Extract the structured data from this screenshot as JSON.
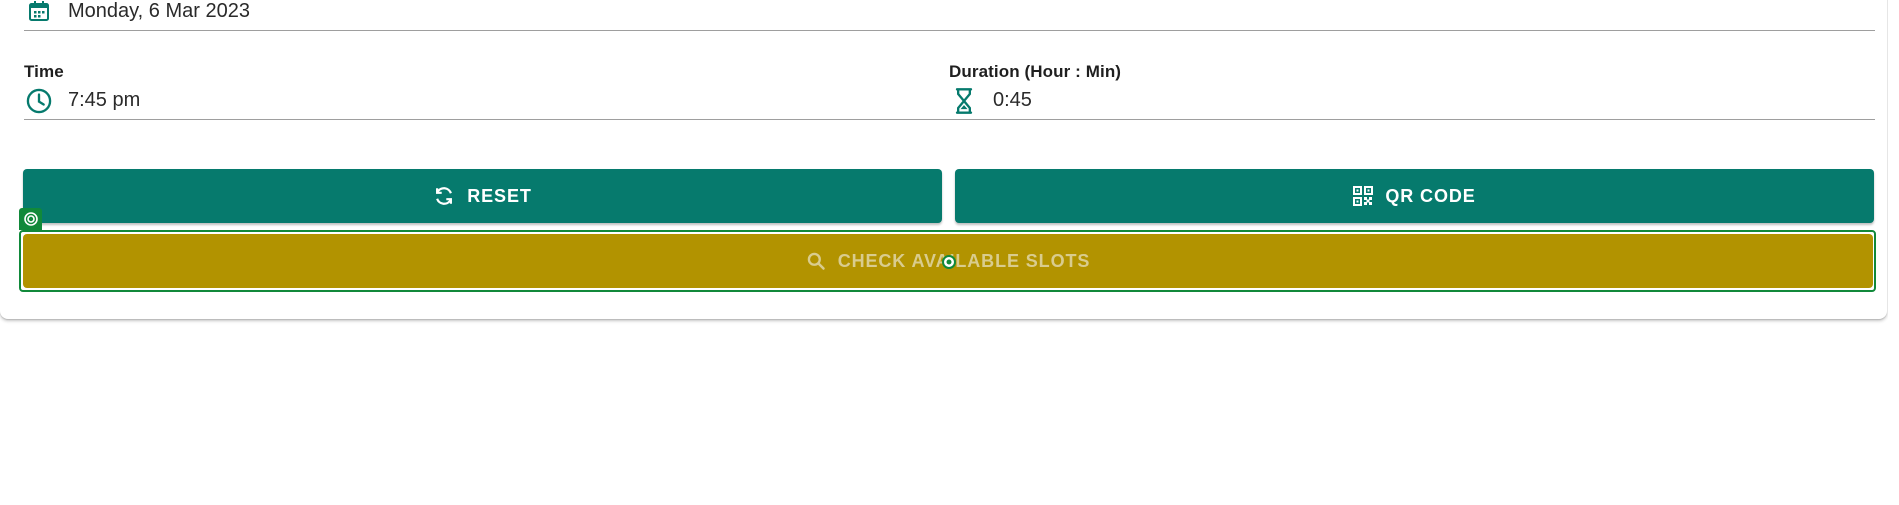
{
  "date_field": {
    "icon": "calendar-icon",
    "value": "Monday, 6 Mar 2023"
  },
  "time_field": {
    "label": "Time",
    "icon": "clock-icon",
    "value": "7:45 pm"
  },
  "duration_field": {
    "label": "Duration (Hour : Min)",
    "icon": "hourglass-icon",
    "value": "0:45"
  },
  "buttons": {
    "reset": {
      "label": "RESET",
      "icon": "refresh-icon"
    },
    "qr_code": {
      "label": "QR CODE",
      "icon": "qr-code-icon"
    },
    "check_slots": {
      "label": "CHECK AVAILABLE SLOTS",
      "icon": "search-icon"
    }
  },
  "colors": {
    "primary": "#067a6d",
    "check_button": "#b29300",
    "check_button_text": "#d9cc8e",
    "highlight_outline": "#11893a"
  }
}
